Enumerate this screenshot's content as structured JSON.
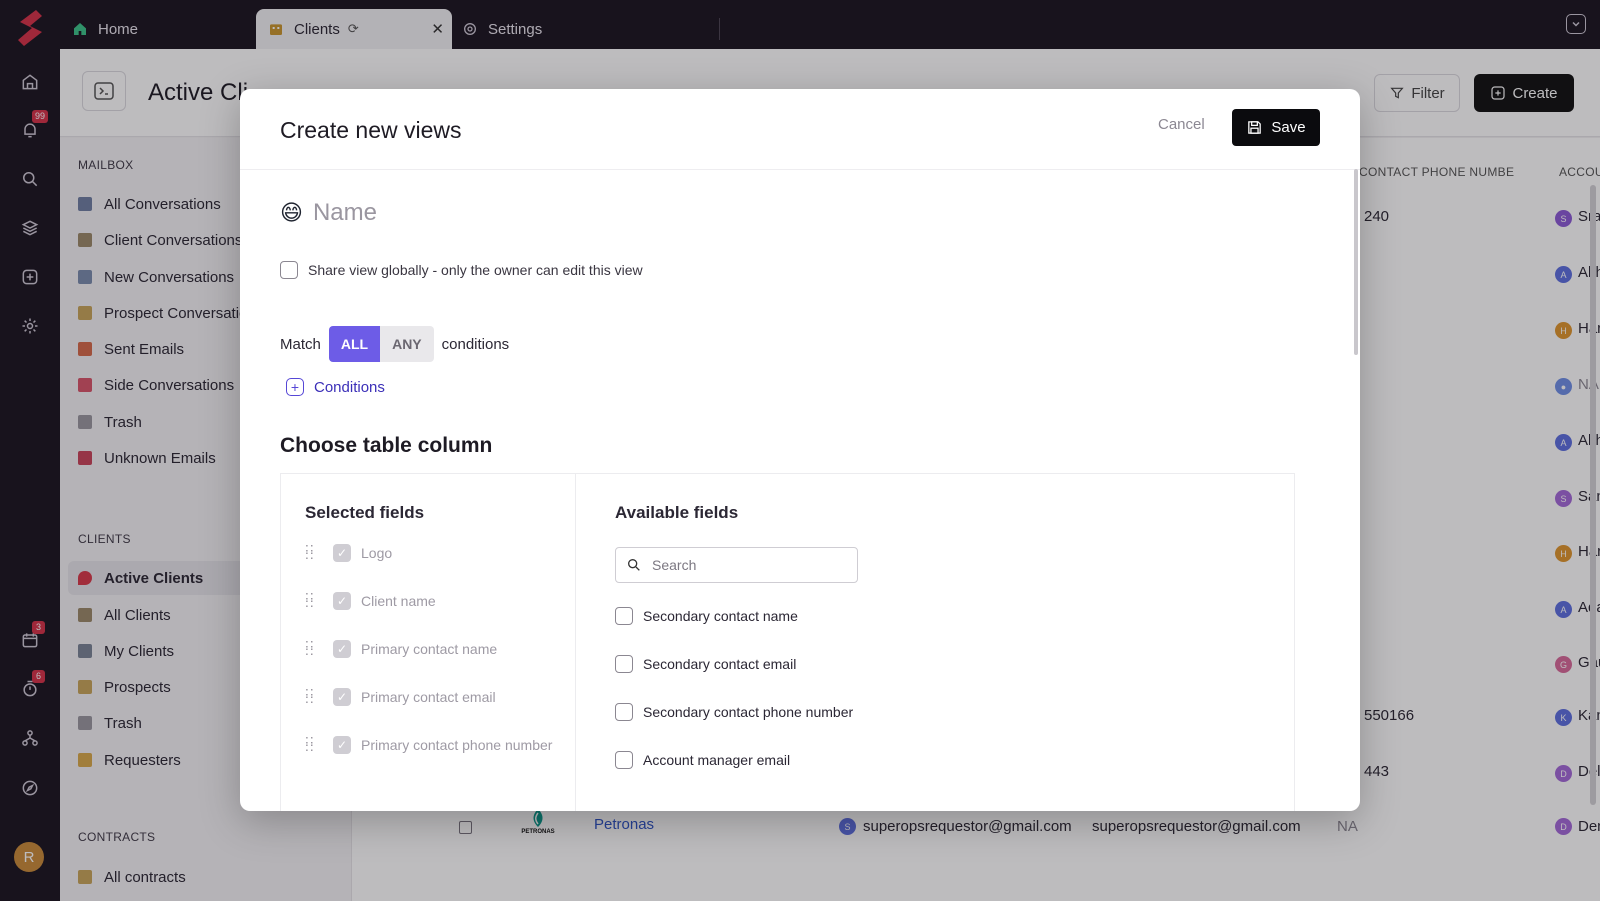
{
  "rail": {
    "notifications_badge": "99",
    "calendar_badge": "3",
    "timer_badge": "6",
    "avatar_initial": "R"
  },
  "tabs": [
    {
      "label": "Home"
    },
    {
      "label": "Clients"
    },
    {
      "label": "Settings"
    }
  ],
  "app": {
    "page_title": "Active Cli",
    "filter_label": "Filter",
    "create_label": "Create"
  },
  "sidebar": {
    "mailbox_label": "MAILBOX",
    "mailbox_items": [
      {
        "label": "All Conversations"
      },
      {
        "label": "Client Conversations"
      },
      {
        "label": "New Conversations"
      },
      {
        "label": "Prospect Conversatio"
      },
      {
        "label": "Sent Emails"
      },
      {
        "label": "Side Conversations"
      },
      {
        "label": "Trash"
      },
      {
        "label": "Unknown Emails"
      }
    ],
    "clients_label": "CLIENTS",
    "clients_items": [
      {
        "label": "Active Clients"
      },
      {
        "label": "All Clients"
      },
      {
        "label": "My Clients"
      },
      {
        "label": "Prospects"
      },
      {
        "label": "Trash"
      },
      {
        "label": "Requesters"
      }
    ],
    "contracts_label": "CONTRACTS",
    "contracts_items": [
      {
        "label": "All contracts"
      }
    ]
  },
  "table": {
    "headers": [
      "CONTACT PHONE NUMBE",
      "ACCOU"
    ],
    "phone_values": [
      "240",
      "550166",
      "443"
    ],
    "accounts": [
      {
        "initial": "S",
        "name": "Srav",
        "color": "#8c5bd6"
      },
      {
        "initial": "A",
        "name": "Akh",
        "color": "#5d6fe0"
      },
      {
        "initial": "H",
        "name": "Hari",
        "color": "#e0962f"
      },
      {
        "initial": "",
        "name": "NA",
        "color": "#6f8fe6"
      },
      {
        "initial": "A",
        "name": "Akh",
        "color": "#5d6fe0"
      },
      {
        "initial": "S",
        "name": "San",
        "color": "#a46ad8"
      },
      {
        "initial": "H",
        "name": "Hari",
        "color": "#e0962f"
      },
      {
        "initial": "A",
        "name": "Ada",
        "color": "#5d6fe0"
      },
      {
        "initial": "G",
        "name": "Gau",
        "color": "#d86a9a"
      },
      {
        "initial": "K",
        "name": "Kan",
        "color": "#5d6fe0"
      },
      {
        "initial": "D",
        "name": "Dele",
        "color": "#a46ad8"
      },
      {
        "initial": "D",
        "name": "Den",
        "color": "#a46ad8"
      }
    ],
    "petronas_row": {
      "logo_text": "PETRONAS",
      "name": "Petronas",
      "requester_initial": "S",
      "requester_email": "superopsrequestor@gmail.com",
      "contact_email": "superopsrequestor@gmail.com",
      "phone": "NA"
    }
  },
  "modal": {
    "title": "Create new views",
    "cancel_label": "Cancel",
    "save_label": "Save",
    "name_emoji": "😄",
    "name_placeholder": "Name",
    "share_label": "Share view globally - only the owner can edit this view",
    "match_label": "Match",
    "match_all": "ALL",
    "match_any": "ANY",
    "conditions_suffix": "conditions",
    "add_conditions_label": "Conditions",
    "section_title": "Choose table column",
    "selected_title": "Selected fields",
    "selected_fields": [
      {
        "label": "Logo"
      },
      {
        "label": "Client name"
      },
      {
        "label": "Primary contact name"
      },
      {
        "label": "Primary contact email"
      },
      {
        "label": "Primary contact phone number"
      }
    ],
    "available_title": "Available fields",
    "search_placeholder": "Search",
    "available_fields": [
      {
        "label": "Secondary contact name"
      },
      {
        "label": "Secondary contact email"
      },
      {
        "label": "Secondary contact phone number"
      },
      {
        "label": "Account manager email"
      }
    ]
  },
  "colors": {
    "accent": "#6d5ce7",
    "link": "#3b2fb8",
    "brand": "#d63249",
    "primary_button": "#0b0b0e"
  }
}
